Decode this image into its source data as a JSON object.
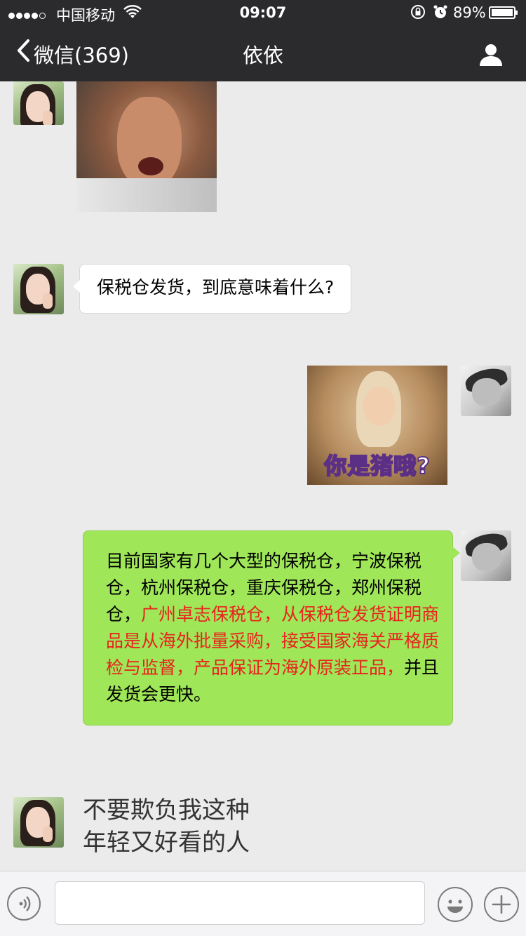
{
  "status_bar": {
    "carrier": "中国移动",
    "time": "09:07",
    "battery_percent": "89%",
    "battery_level": 0.89,
    "signal_icon": "signal-dots-icon",
    "wifi_icon": "wifi-icon",
    "rotation_lock_icon": "rotation-lock-icon",
    "alarm_icon": "alarm-icon"
  },
  "nav": {
    "back_label": "微信(369)",
    "title": "依依",
    "back_icon": "chevron-left-icon",
    "profile_icon": "person-icon"
  },
  "messages": {
    "msg1_sticker_icon": "sticker-surprised-man",
    "msg2_text": "保税仓发货，到底意味着什么?",
    "msg3_sticker_caption": "你是猪哦?",
    "msg4": {
      "part1": "目前国家有几个大型的保税仓，宁波保税仓，杭州保税仓，重庆保税仓，郑州保税仓，",
      "part2_red": "广州卓志保税仓，从保税仓发货证明商品是从海外批量采购，接受国家海关严格质检与监督，产品保证为海外原装正品，",
      "part3": "并且发货会更快。"
    },
    "msg5_line1": "不要欺负我这种",
    "msg5_line2": "年轻又好看的人"
  },
  "toolbar": {
    "voice_icon": "voice-icon",
    "input_value": "",
    "emoji_icon": "emoji-icon",
    "plus_icon": "plus-icon"
  },
  "colors": {
    "nav_bg": "#2b2b2e",
    "chat_bg": "#ebebeb",
    "bubble_green": "#9fe658",
    "bubble_white": "#ffffff",
    "highlight_red": "#e8231e"
  }
}
